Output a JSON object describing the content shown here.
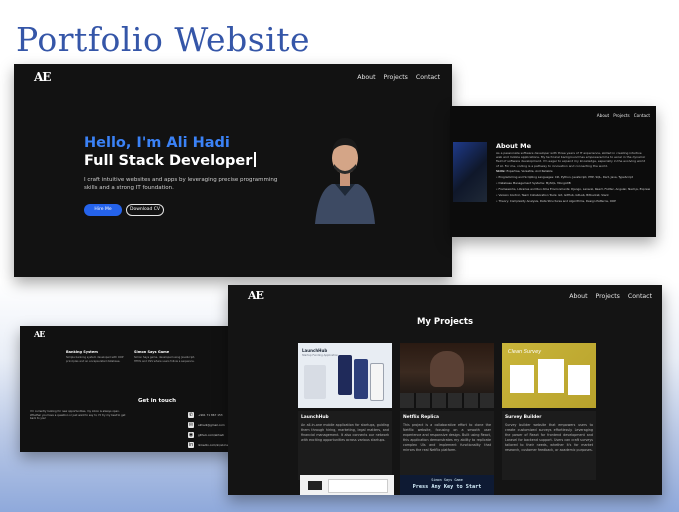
{
  "page": {
    "heading": "Portfolio Website"
  },
  "nav": {
    "logo": "AE",
    "items": [
      "About",
      "Projects",
      "Contact"
    ]
  },
  "hero": {
    "greeting": "Hello, I'm Ali Hadi",
    "role": "Full Stack Developer",
    "description": "I craft intuitive websites and apps by leveraging precise programming skills and a strong IT foundation.",
    "hire_button": "Hire Me",
    "cv_button": "Download CV"
  },
  "about": {
    "title": "About Me",
    "description": "As a passionate software developer with three years of IT experience, skilled in creating intuitive web and mobile applications. My technical background has empowered me to excel in the dynamic field of software development. I'm eager to expand my knowledge, especially in the evolving world of AI. For me, coding is a pathway to innovation and connecting the world.",
    "skills_label": "Skills:",
    "skills_summary": "Expertise, Versatile, And Reliable",
    "skills": [
      "Programming and Scripting Languages: C#, Python, JavaScript, PHP, SQL, Dart, Java, TypeScript",
      "Database Management Systems: MySQL, MongoDB",
      "Frameworks, Libraries and Run-time Environments: Django, Laravel, React, Flutter, Angular, Next.js, Express, Node.js",
      "Version Control, Team Collaboration Tools: Git, GitHub, GitLab, Bitbucket, Slack",
      "Theory: Complexity Analysis, Data Structures and Algorithms, Design Patterns, OOP"
    ]
  },
  "contact": {
    "cards": [
      {
        "title": "Banking System",
        "desc": "Simple banking system developed with OOP principles and an encapsulated database."
      },
      {
        "title": "Simon Says Game",
        "desc": "Simon Says game, developed using JavaScript, HTML and CSS where users follow a sequence."
      }
    ],
    "title": "Get in touch",
    "desc": "I'm currently looking for new opportunities, my inbox is always open. Whether you have a question or just want to say hi, I'll try my best to get back to you!",
    "items": [
      {
        "icon": "phone-icon",
        "glyph": "✆",
        "text": "+961 71 867 153"
      },
      {
        "icon": "email-icon",
        "glyph": "✉",
        "text": "alihadi@gmail.com"
      },
      {
        "icon": "github-icon",
        "glyph": "◉",
        "text": "github.com/alihadi"
      },
      {
        "icon": "linkedin-icon",
        "glyph": "in",
        "text": "linkedin.com/in/ali-hadi"
      }
    ]
  },
  "projects": {
    "title": "My Projects",
    "items": [
      {
        "name": "LaunchHub",
        "thumb_label": "Startup Funding Application",
        "desc": "An all-in-one mobile application for startups, guiding them through hiring, marketing, legal matters, and financial management. It also connects our network with exciting opportunities across various startups."
      },
      {
        "name": "Netflix Replica",
        "desc": "This project is a collaborative effort to clone the Netflix website, focusing on a smooth user experience and responsive design. Built using React, this application demonstrates my ability to replicate complex UIs and implement functionality that mirrors the real Netflix platform."
      },
      {
        "name": "Survey Builder",
        "thumb_label": "Clean Survey",
        "desc": "Survey builder website that empowers users to create customized surveys effortlessly. Leveraging the power of React for frontend development and Laravel for backend support. Users can craft surveys tailored to their needs, whether it's for market research, customer feedback, or academic purposes."
      }
    ],
    "game": {
      "line1": "Simon Says Game",
      "line2": "Press Any Key to Start"
    }
  },
  "colors": {
    "accent": "#3b82f6",
    "heading": "#3556a8",
    "panel": "#121212"
  }
}
